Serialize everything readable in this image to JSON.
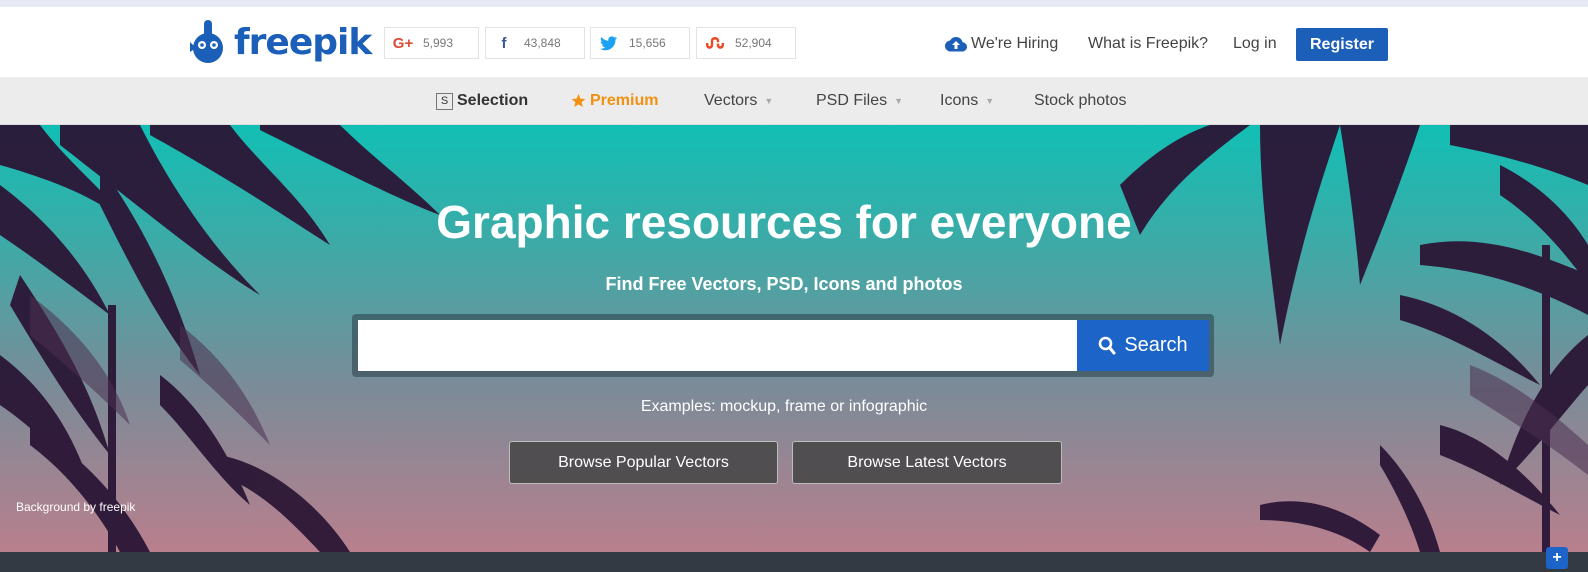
{
  "brand": {
    "name": "freepik",
    "color": "#1b5fb9"
  },
  "social": [
    {
      "icon": "google-plus-icon",
      "glyph": "G+",
      "count": "5,993",
      "color": "#dd4b39"
    },
    {
      "icon": "facebook-icon",
      "glyph": "f",
      "count": "43,848",
      "color": "#3b5998"
    },
    {
      "icon": "twitter-icon",
      "glyph": "t",
      "count": "15,656",
      "color": "#1da1f2"
    },
    {
      "icon": "stumbleupon-icon",
      "glyph": "su",
      "count": "52,904",
      "color": "#eb4924"
    }
  ],
  "header_links": {
    "hiring": "We're Hiring",
    "what_is": "What is Freepik?",
    "login": "Log in",
    "register": "Register"
  },
  "nav": {
    "selection_icon": "S",
    "selection": "Selection",
    "premium": "Premium",
    "vectors": "Vectors",
    "psd": "PSD Files",
    "icons": "Icons",
    "stock": "Stock photos"
  },
  "hero": {
    "title": "Graphic resources for everyone",
    "subtitle": "Find Free Vectors, PSD, Icons and photos",
    "search_placeholder": "",
    "search_button": "Search",
    "examples": "Examples: mockup, frame or infographic",
    "browse_popular": "Browse Popular Vectors",
    "browse_latest": "Browse Latest Vectors",
    "credit": "Background by freepik"
  },
  "corner_button": "+",
  "colors": {
    "accent": "#1c64c8",
    "premium": "#f29111",
    "hero_top": "#11bfb4",
    "hero_bottom": "#b97f8d"
  }
}
